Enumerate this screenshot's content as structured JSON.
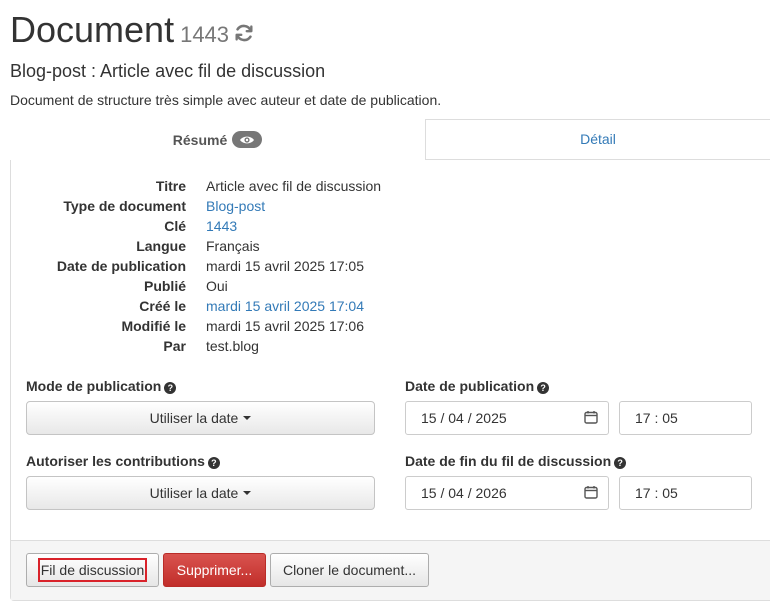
{
  "header": {
    "title": "Document",
    "doc_id": "1443",
    "subtitle": "Blog-post : Article avec fil de discussion",
    "description": "Document de structure très simple avec auteur et date de publication."
  },
  "tabs": {
    "summary": "Résumé",
    "detail": "Détail"
  },
  "properties": [
    {
      "label": "Titre",
      "value": "Article avec fil de discussion",
      "link": false
    },
    {
      "label": "Type de document",
      "value": "Blog-post",
      "link": true
    },
    {
      "label": "Clé",
      "value": "1443",
      "link": true
    },
    {
      "label": "Langue",
      "value": "Français",
      "link": false
    },
    {
      "label": "Date de publication",
      "value": "mardi 15 avril 2025 17:05",
      "link": false
    },
    {
      "label": "Publié",
      "value": "Oui",
      "link": false
    },
    {
      "label": "Créé le",
      "value": "mardi 15 avril 2025 17:04",
      "link": true
    },
    {
      "label": "Modifié le",
      "value": "mardi 15 avril 2025 17:06",
      "link": false
    },
    {
      "label": "Par",
      "value": "test.blog",
      "link": false
    }
  ],
  "form": {
    "publication_mode_label": "Mode de publication",
    "publication_mode_value": "Utiliser la date",
    "publication_date_label": "Date de publication",
    "publication_date": {
      "day": "15",
      "month": "04",
      "year": "2025"
    },
    "publication_time": {
      "hour": "17",
      "minute": "05"
    },
    "contributions_label": "Autoriser les contributions",
    "contributions_value": "Utiliser la date",
    "thread_end_label": "Date de fin du fil de discussion",
    "thread_end_date": {
      "day": "15",
      "month": "04",
      "year": "2026"
    },
    "thread_end_time": {
      "hour": "17",
      "minute": "05"
    }
  },
  "actions": {
    "thread_button": "Fil de discussion",
    "delete_button": "Supprimer...",
    "clone_button": "Cloner le document..."
  },
  "colors": {
    "link": "#337ab7",
    "danger": "#d9534f",
    "badge": "#777777"
  }
}
